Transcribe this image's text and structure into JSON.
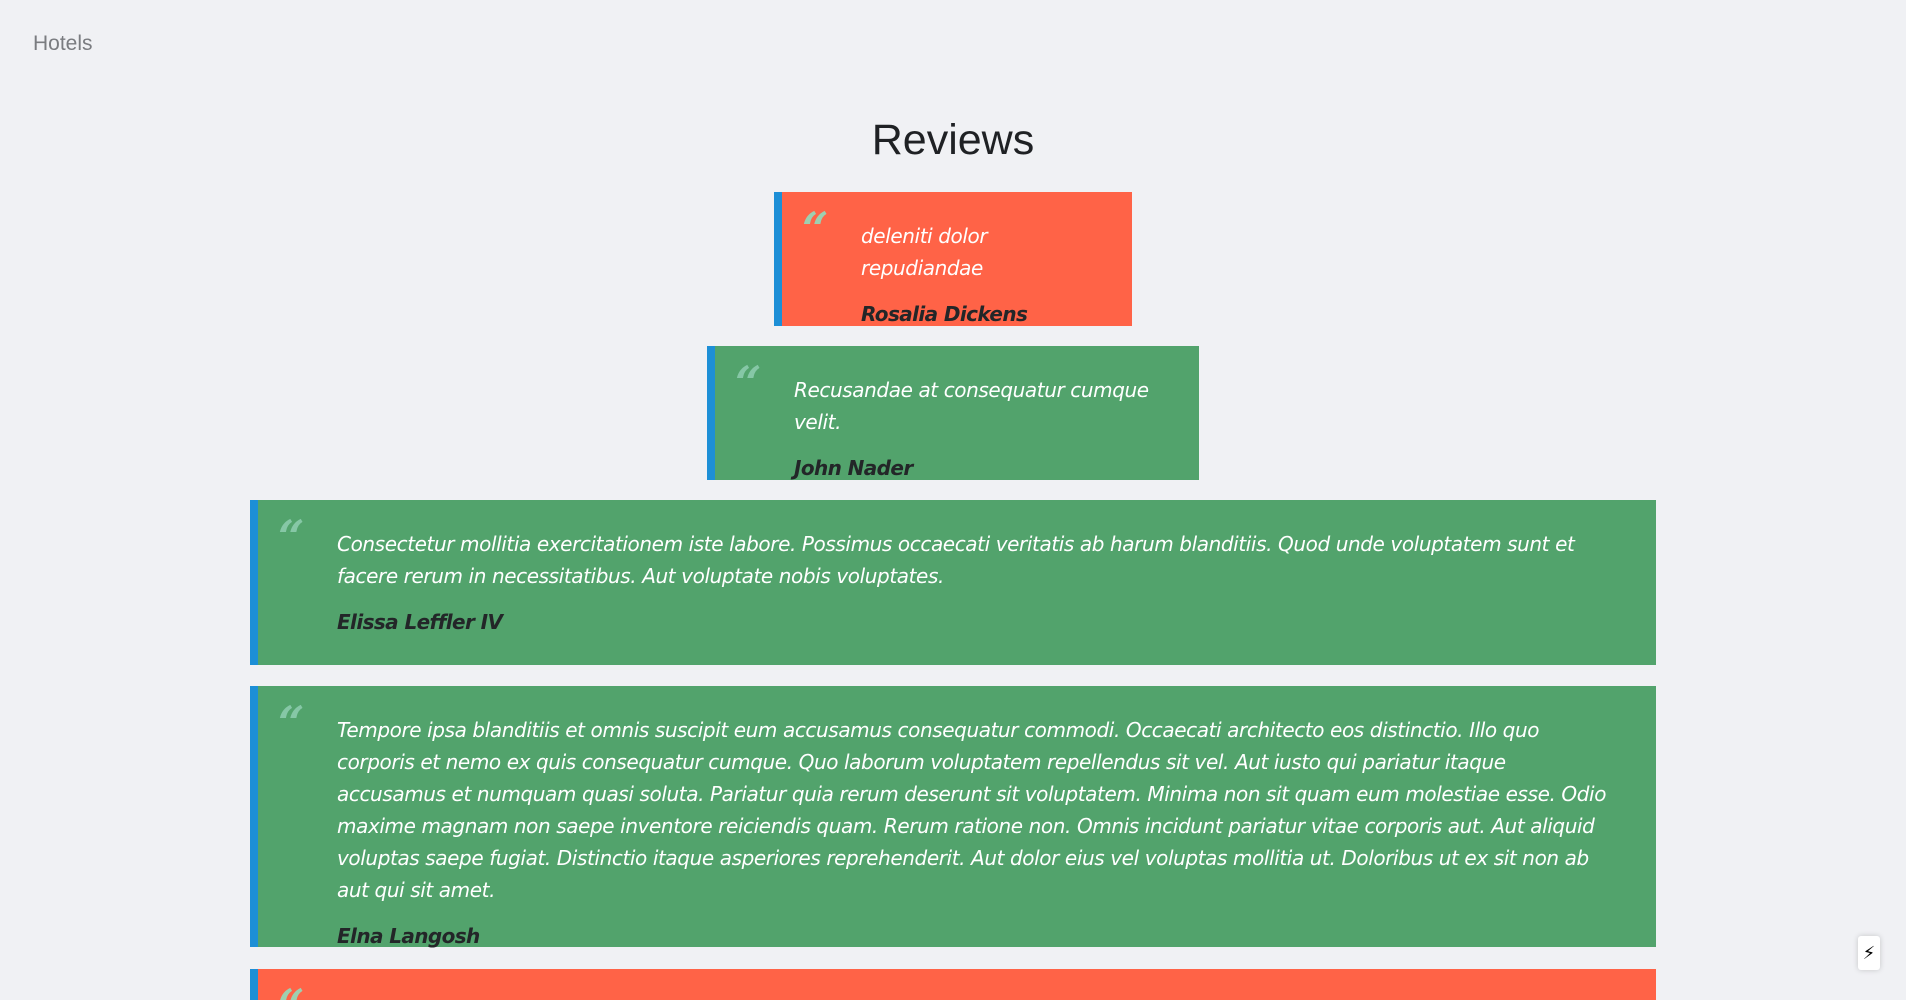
{
  "nav": {
    "hotels_label": "Hotels"
  },
  "page": {
    "title": "Reviews"
  },
  "reviews": [
    {
      "sentiment": "negative",
      "color": "#ff6347",
      "body": "deleniti dolor repudiandae",
      "author": "Rosalia Dickens"
    },
    {
      "sentiment": "positive",
      "color": "#52a36c",
      "body": "Recusandae at consequatur cumque velit.",
      "author": "John Nader"
    },
    {
      "sentiment": "positive",
      "color": "#52a36c",
      "body": "Consectetur mollitia exercitationem iste labore. Possimus occaecati veritatis ab harum blanditiis. Quod unde voluptatem sunt et facere rerum in necessitatibus. Aut voluptate nobis voluptates.",
      "author": "Elissa Leffler IV"
    },
    {
      "sentiment": "positive",
      "color": "#52a36c",
      "body": "Tempore ipsa blanditiis et omnis suscipit eum accusamus consequatur commodi. Occaecati architecto eos distinctio. Illo quo corporis et nemo ex quis consequatur cumque. Quo laborum voluptatem repellendus sit vel. Aut iusto qui pariatur itaque accusamus et numquam quasi soluta. Pariatur quia rerum deserunt sit voluptatem. Minima non sit quam eum molestiae esse. Odio maxime magnam non saepe inventore reiciendis quam. Rerum ratione non. Omnis incidunt pariatur vitae corporis aut. Aut aliquid voluptas saepe fugiat. Distinctio itaque asperiores reprehenderit. Aut dolor eius vel voluptas mollitia ut. Doloribus ut ex sit non ab aut qui sit amet.",
      "author": "Elna Langosh"
    },
    {
      "sentiment": "negative",
      "color": "#ff6347"
    }
  ],
  "quote_glyph": "“",
  "icons": {
    "flash": "lightning-bolt-icon",
    "flash_glyph": "⚡"
  }
}
